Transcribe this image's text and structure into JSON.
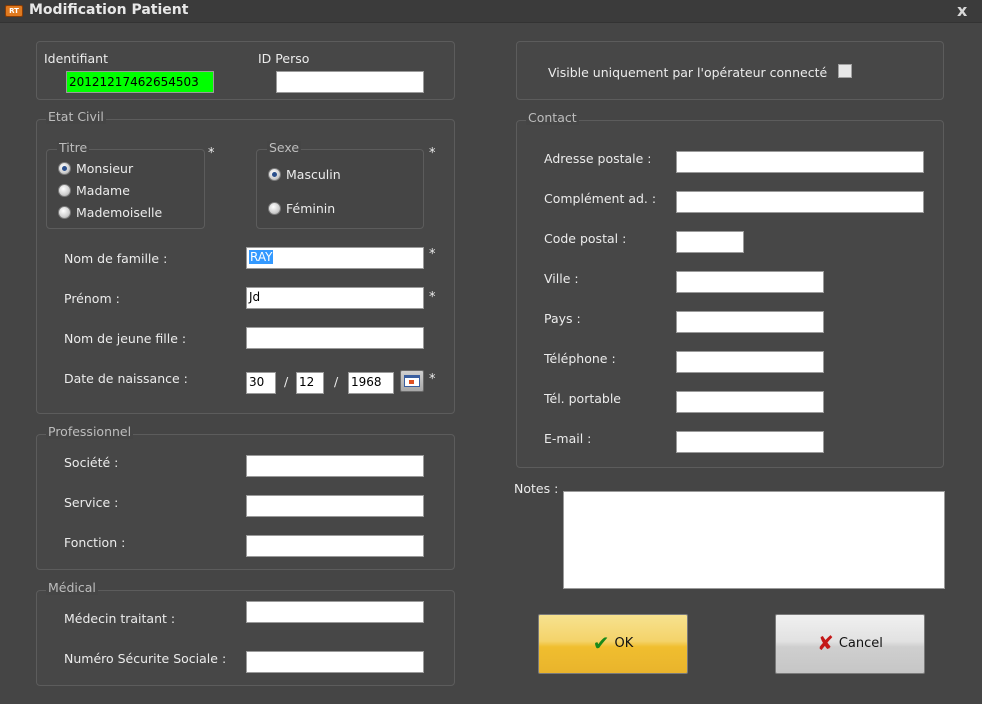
{
  "window": {
    "app_icon_text": "RT",
    "title": "Modification Patient",
    "close_glyph": "x"
  },
  "identity": {
    "identifiant_label": "Identifiant",
    "identifiant_value": "20121217462654503",
    "id_perso_label": "ID Perso",
    "id_perso_value": ""
  },
  "visibility": {
    "label": "Visible uniquement par l'opérateur connecté",
    "checked": false
  },
  "etat_civil": {
    "legend": "Etat Civil",
    "titre": {
      "legend": "Titre",
      "options": [
        "Monsieur",
        "Madame",
        "Mademoiselle"
      ],
      "selected": "Monsieur"
    },
    "sexe": {
      "legend": "Sexe",
      "options": [
        "Masculin",
        "Féminin"
      ],
      "selected": "Masculin"
    },
    "required_mark": "*",
    "nom_label": "Nom de famille :",
    "nom_value": "RAY",
    "prenom_label": "Prénom :",
    "prenom_value": "Jd",
    "jeune_fille_label": "Nom de jeune fille :",
    "jeune_fille_value": "",
    "naissance_label": "Date de naissance :",
    "day": "30",
    "month": "12",
    "year": "1968",
    "date_sep": "/",
    "calendar_icon": "calendar-icon"
  },
  "professionnel": {
    "legend": "Professionnel",
    "societe_label": "Société :",
    "societe_value": "",
    "service_label": "Service :",
    "service_value": "",
    "fonction_label": "Fonction :",
    "fonction_value": ""
  },
  "medical": {
    "legend": "Médical",
    "medecin_label": "Médecin traitant :",
    "medecin_value": "",
    "secu_label": "Numéro Sécurite Sociale :",
    "secu_value": ""
  },
  "contact": {
    "legend": "Contact",
    "adresse_label": "Adresse postale :",
    "adresse_value": "",
    "complement_label": "Complément ad. :",
    "complement_value": "",
    "cp_label": "Code postal :",
    "cp_value": "",
    "ville_label": "Ville :",
    "ville_value": "",
    "pays_label": "Pays :",
    "pays_value": "",
    "telephone_label": "Téléphone :",
    "telephone_value": "",
    "portable_label": "Tél. portable",
    "portable_value": "",
    "email_label": "E-mail :",
    "email_value": ""
  },
  "notes": {
    "label": "Notes :",
    "value": ""
  },
  "buttons": {
    "ok_label": "OK",
    "ok_icon": "check-icon",
    "cancel_label": "Cancel",
    "cancel_icon": "cross-icon"
  },
  "colors": {
    "window_bg": "#454545",
    "identifiant_bg": "#00ff00",
    "selection_bg": "#3399ff",
    "ok_button": "#f0be2f",
    "check_green": "#1a8a1a",
    "cancel_red": "#c41818"
  }
}
